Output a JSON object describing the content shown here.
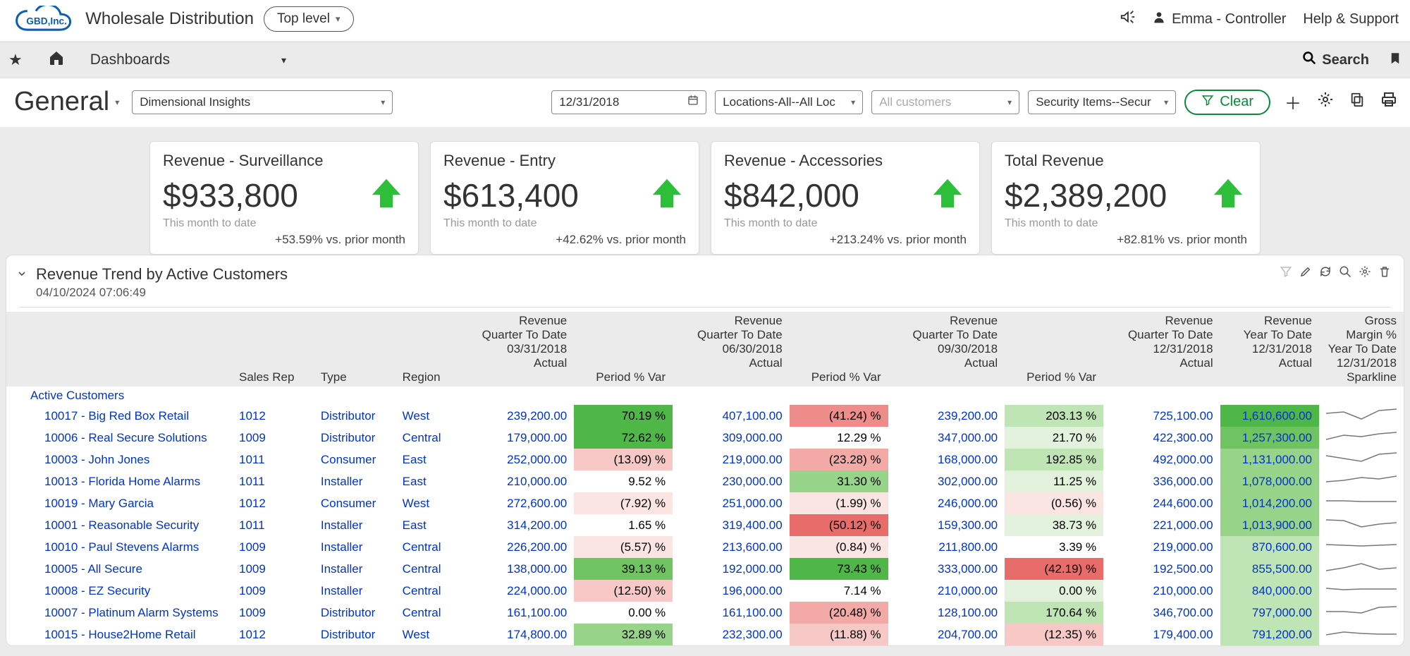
{
  "header": {
    "app_title": "Wholesale Distribution",
    "top_level": "Top level",
    "user": "Emma - Controller",
    "help": "Help & Support"
  },
  "nav": {
    "menu": "Dashboards",
    "search": "Search"
  },
  "filter": {
    "page_title": "General",
    "insight": "Dimensional Insights",
    "date": "12/31/2018",
    "location": "Locations-All--All Loc",
    "customers_placeholder": "All customers",
    "security": "Security Items--Secur",
    "clear": "Clear"
  },
  "cards": [
    {
      "title": "Revenue - Surveillance",
      "value": "$933,800",
      "sub": "This month to date",
      "foot": "+53.59% vs. prior month"
    },
    {
      "title": "Revenue - Entry",
      "value": "$613,400",
      "sub": "This month to date",
      "foot": "+42.62% vs. prior month"
    },
    {
      "title": "Revenue - Accessories",
      "value": "$842,000",
      "sub": "This month to date",
      "foot": "+213.24% vs. prior month"
    },
    {
      "title": "Total Revenue",
      "value": "$2,389,200",
      "sub": "This month to date",
      "foot": "+82.81% vs. prior month"
    }
  ],
  "panel": {
    "title": "Revenue Trend by Active Customers",
    "timestamp": "04/10/2024 07:06:49",
    "group_label": "Active Customers",
    "columns": {
      "sales_rep": "Sales Rep",
      "type": "Type",
      "region": "Region",
      "q1_h1": "Revenue",
      "q1_h2": "Quarter To Date",
      "q1_h3": "03/31/2018",
      "q1_h4": "Actual",
      "q2_h1": "Revenue",
      "q2_h2": "Quarter To Date",
      "q2_h3": "06/30/2018",
      "q2_h4a": "Period % Var",
      "q2_h4b": "Actual",
      "q3_h1": "Revenue",
      "q3_h2": "Quarter To Date",
      "q3_h3": "09/30/2018",
      "q3_h4a": "Period % Var",
      "q3_h4b": "Actual",
      "q4_h1": "Revenue",
      "q4_h2": "Quarter To Date",
      "q4_h3": "12/31/2018",
      "q4_h4a": "Period % Var",
      "q4_h4b": "Actual",
      "ytd_h1": "Revenue",
      "ytd_h2": "Year To Date",
      "ytd_h3": "12/31/2018",
      "ytd_h4": "Actual",
      "gm_h1": "Gross Margin %",
      "gm_h2": "Year To Date",
      "gm_h3": "12/31/2018",
      "gm_h4": "Sparkline"
    },
    "rows": [
      {
        "name": "10017 - Big Red Box Retail",
        "rep": "1012",
        "type": "Distributor",
        "region": "West",
        "q1": "239,200.00",
        "p2": "70.19 %",
        "p2c": "heat-g5",
        "q2": "407,100.00",
        "p3": "(41.24) %",
        "p3c": "heat-r4",
        "q3": "239,200.00",
        "p4": "203.13 %",
        "p4c": "heat-g2",
        "q4": "725,100.00",
        "ytd": "1,610,600.00",
        "ytdc": "heat-g5"
      },
      {
        "name": "10006 - Real Secure Solutions",
        "rep": "1009",
        "type": "Distributor",
        "region": "Central",
        "q1": "179,000.00",
        "p2": "72.62 %",
        "p2c": "heat-g5",
        "q2": "309,000.00",
        "p3": "12.29 %",
        "p3c": "",
        "q3": "347,000.00",
        "p4": "21.70 %",
        "p4c": "heat-g1",
        "q4": "422,300.00",
        "ytd": "1,257,300.00",
        "ytdc": "heat-g4"
      },
      {
        "name": "10003 - John Jones",
        "rep": "1011",
        "type": "Consumer",
        "region": "East",
        "q1": "252,000.00",
        "p2": "(13.09) %",
        "p2c": "heat-r2",
        "q2": "219,000.00",
        "p3": "(23.28) %",
        "p3c": "heat-r3",
        "q3": "168,000.00",
        "p4": "192.85 %",
        "p4c": "heat-g2",
        "q4": "492,000.00",
        "ytd": "1,131,000.00",
        "ytdc": "heat-g3"
      },
      {
        "name": "10013 - Florida Home Alarms",
        "rep": "1011",
        "type": "Installer",
        "region": "East",
        "q1": "210,000.00",
        "p2": "9.52 %",
        "p2c": "",
        "q2": "230,000.00",
        "p3": "31.30 %",
        "p3c": "heat-g3",
        "q3": "302,000.00",
        "p4": "11.25 %",
        "p4c": "heat-g1",
        "q4": "336,000.00",
        "ytd": "1,078,000.00",
        "ytdc": "heat-g3"
      },
      {
        "name": "10019 - Mary Garcia",
        "rep": "1012",
        "type": "Consumer",
        "region": "West",
        "q1": "272,600.00",
        "p2": "(7.92) %",
        "p2c": "heat-r1",
        "q2": "251,000.00",
        "p3": "(1.99) %",
        "p3c": "heat-r1",
        "q3": "246,000.00",
        "p4": "(0.56) %",
        "p4c": "heat-r1",
        "q4": "244,600.00",
        "ytd": "1,014,200.00",
        "ytdc": "heat-g3"
      },
      {
        "name": "10001 - Reasonable Security",
        "rep": "1011",
        "type": "Installer",
        "region": "East",
        "q1": "314,200.00",
        "p2": "1.65 %",
        "p2c": "",
        "q2": "319,400.00",
        "p3": "(50.12) %",
        "p3c": "heat-r5",
        "q3": "159,300.00",
        "p4": "38.73 %",
        "p4c": "heat-g1",
        "q4": "221,000.00",
        "ytd": "1,013,900.00",
        "ytdc": "heat-g3"
      },
      {
        "name": "10010 - Paul Stevens Alarms",
        "rep": "1009",
        "type": "Installer",
        "region": "Central",
        "q1": "226,200.00",
        "p2": "(5.57) %",
        "p2c": "heat-r1",
        "q2": "213,600.00",
        "p3": "(0.84) %",
        "p3c": "heat-r1",
        "q3": "211,800.00",
        "p4": "3.39 %",
        "p4c": "",
        "q4": "219,000.00",
        "ytd": "870,600.00",
        "ytdc": "heat-g2"
      },
      {
        "name": "10005 - All Secure",
        "rep": "1009",
        "type": "Installer",
        "region": "Central",
        "q1": "138,000.00",
        "p2": "39.13 %",
        "p2c": "heat-g4",
        "q2": "192,000.00",
        "p3": "73.43 %",
        "p3c": "heat-g5",
        "q3": "333,000.00",
        "p4": "(42.19) %",
        "p4c": "heat-r5",
        "q4": "192,500.00",
        "ytd": "855,500.00",
        "ytdc": "heat-g2"
      },
      {
        "name": "10008 - EZ Security",
        "rep": "1009",
        "type": "Installer",
        "region": "Central",
        "q1": "224,000.00",
        "p2": "(12.50) %",
        "p2c": "heat-r2",
        "q2": "196,000.00",
        "p3": "7.14 %",
        "p3c": "",
        "q3": "210,000.00",
        "p4": "0.00 %",
        "p4c": "heat-g1",
        "q4": "210,000.00",
        "ytd": "840,000.00",
        "ytdc": "heat-g2"
      },
      {
        "name": "10007 - Platinum Alarm Systems",
        "rep": "1009",
        "type": "Distributor",
        "region": "Central",
        "q1": "161,100.00",
        "p2": "0.00 %",
        "p2c": "",
        "q2": "161,100.00",
        "p3": "(20.48) %",
        "p3c": "heat-r3",
        "q3": "128,100.00",
        "p4": "170.64 %",
        "p4c": "heat-g2",
        "q4": "346,700.00",
        "ytd": "797,000.00",
        "ytdc": "heat-g2"
      },
      {
        "name": "10015 - House2Home Retail",
        "rep": "1012",
        "type": "Distributor",
        "region": "West",
        "q1": "174,800.00",
        "p2": "32.89 %",
        "p2c": "heat-g3",
        "q2": "232,300.00",
        "p3": "(11.88) %",
        "p3c": "heat-r2",
        "q3": "204,700.00",
        "p4": "(12.35) %",
        "p4c": "heat-r2",
        "q4": "179,400.00",
        "ytd": "791,200.00",
        "ytdc": "heat-g2"
      }
    ]
  }
}
